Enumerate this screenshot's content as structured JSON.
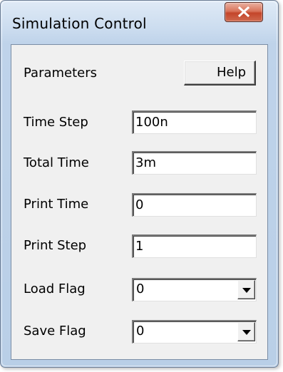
{
  "window": {
    "title": "Simulation Control",
    "close_icon": "close-icon"
  },
  "parameters": {
    "heading": "Parameters",
    "help_label": "Help"
  },
  "fields": {
    "time_step": {
      "label": "Time Step",
      "value": "100n"
    },
    "total_time": {
      "label": "Total Time",
      "value": "3m"
    },
    "print_time": {
      "label": "Print Time",
      "value": "0"
    },
    "print_step": {
      "label": "Print Step",
      "value": "1"
    },
    "load_flag": {
      "label": "Load Flag",
      "value": "0",
      "icon": "chevron-down-icon"
    },
    "save_flag": {
      "label": "Save Flag",
      "value": "0",
      "icon": "chevron-down-icon"
    }
  },
  "colors": {
    "close_button": "#c4452a",
    "frame": "#bfd3ea",
    "client": "#f0f0f0"
  }
}
